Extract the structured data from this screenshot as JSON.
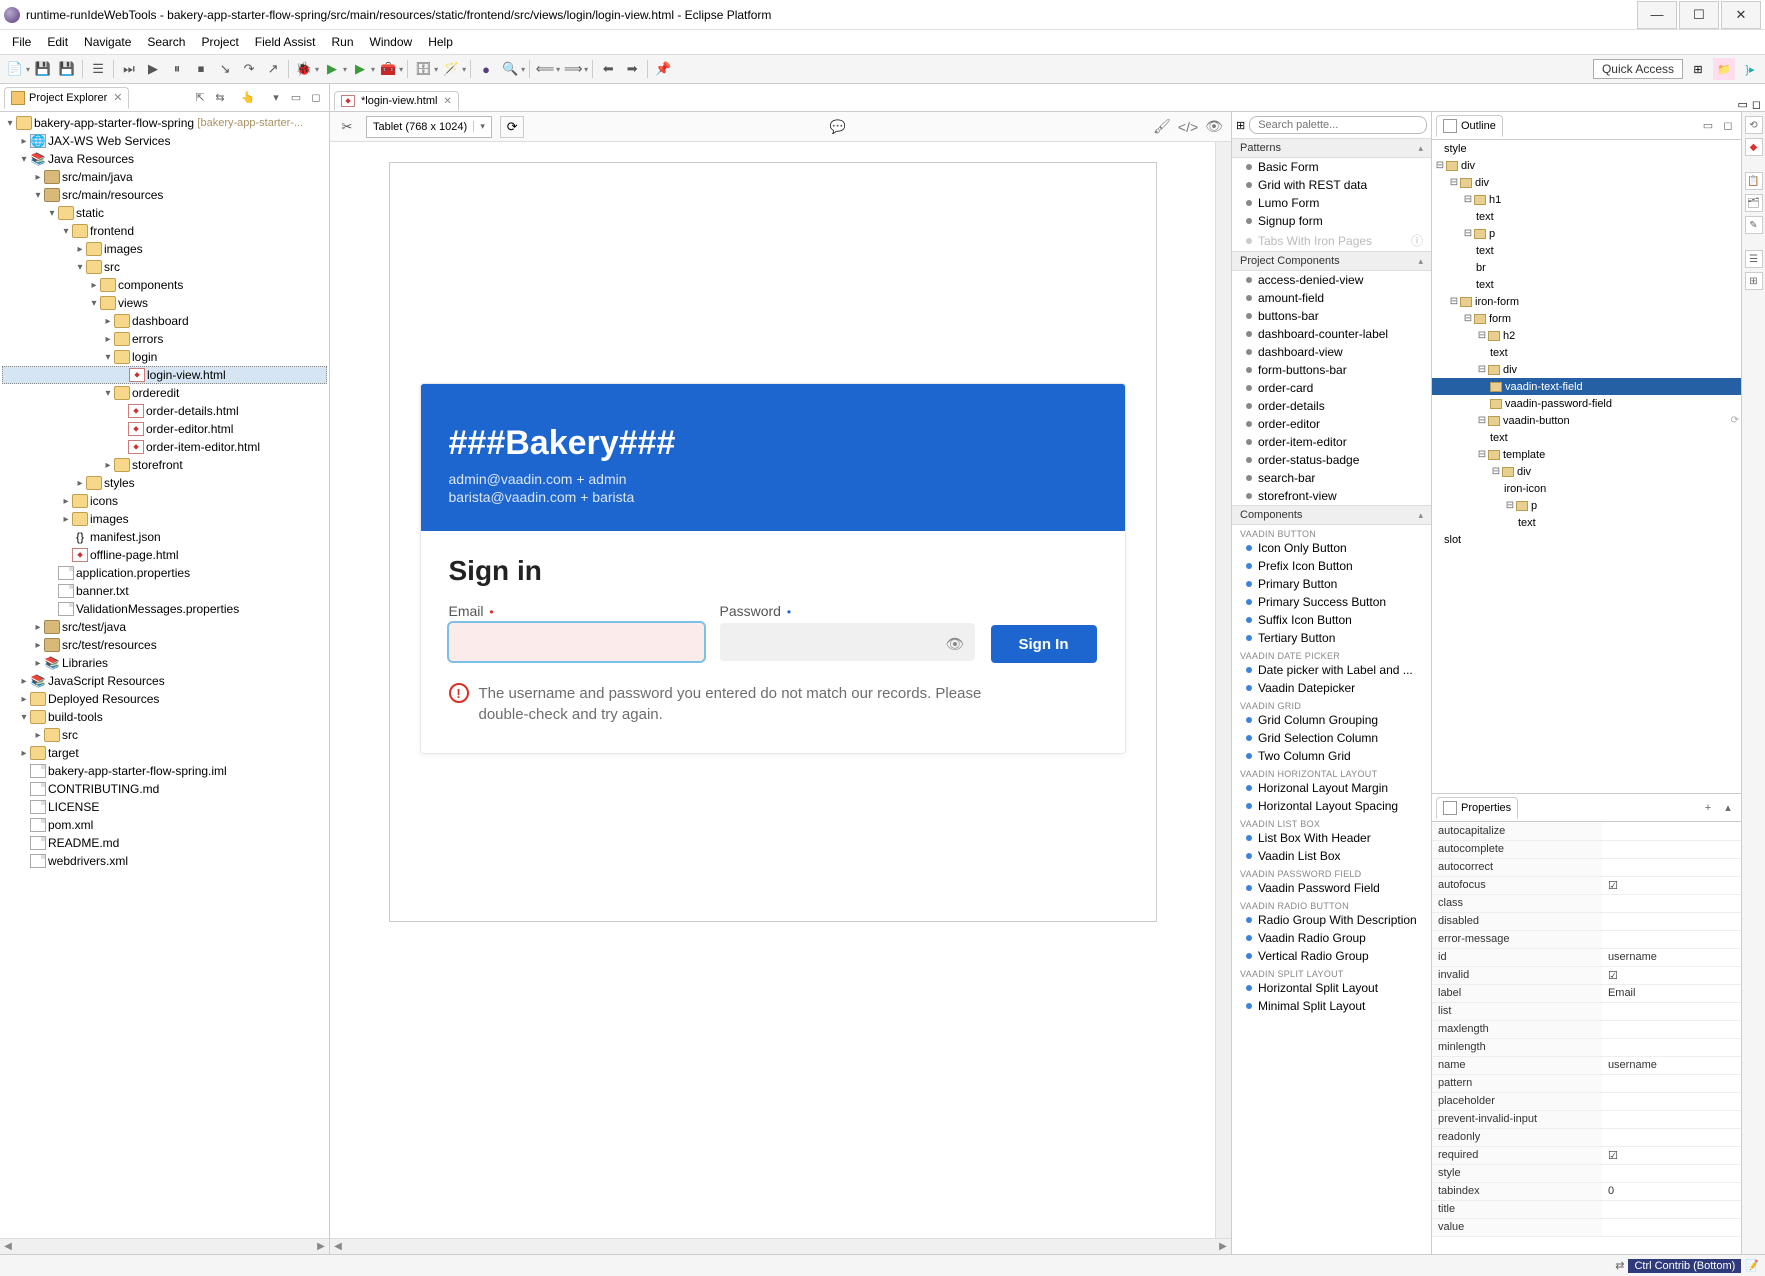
{
  "title": "runtime-runIdeWebTools - bakery-app-starter-flow-spring/src/main/resources/static/frontend/src/views/login/login-view.html - Eclipse Platform",
  "menu": {
    "file": "File",
    "edit": "Edit",
    "navigate": "Navigate",
    "search": "Search",
    "project": "Project",
    "fieldassist": "Field Assist",
    "run": "Run",
    "window": "Window",
    "help": "Help"
  },
  "quick_access": "Quick Access",
  "explorer": {
    "title": "Project Explorer",
    "project": "bakery-app-starter-flow-spring",
    "project_decor": "[bakery-app-starter-...",
    "webservices": "JAX-WS Web Services",
    "javares": "Java Resources",
    "srcmainjava": "src/main/java",
    "srcmainres": "src/main/resources",
    "static": "static",
    "frontend": "frontend",
    "images": "images",
    "src": "src",
    "components": "components",
    "views": "views",
    "dashboard": "dashboard",
    "errors": "errors",
    "login": "login",
    "loginview": "login-view.html",
    "orderedit": "orderedit",
    "orderdetails": "order-details.html",
    "ordereditor": "order-editor.html",
    "orderitemeditor": "order-item-editor.html",
    "storefront": "storefront",
    "styles": "styles",
    "icons": "icons",
    "images2": "images",
    "manifest": "manifest.json",
    "offlinepage": "offline-page.html",
    "appprops": "application.properties",
    "banner": "banner.txt",
    "valmsgs": "ValidationMessages.properties",
    "srctestjava": "src/test/java",
    "srctestres": "src/test/resources",
    "libraries": "Libraries",
    "jsres": "JavaScript Resources",
    "depres": "Deployed Resources",
    "buildtools": "build-tools",
    "src2": "src",
    "target": "target",
    "iml": "bakery-app-starter-flow-spring.iml",
    "contributing": "CONTRIBUTING.md",
    "license": "LICENSE",
    "pom": "pom.xml",
    "readme": "README.md",
    "webdrivers": "webdrivers.xml"
  },
  "editor": {
    "tab": "*login-view.html",
    "device": "Tablet (768 x 1024)"
  },
  "login": {
    "title": "###Bakery###",
    "creds1": "admin@vaadin.com + admin",
    "creds2": "barista@vaadin.com + barista",
    "signin_heading": "Sign in",
    "email_label": "Email",
    "password_label": "Password",
    "signin_btn": "Sign In",
    "error": "The username and password you entered do not match our records. Please double-check and try again."
  },
  "palette": {
    "search_placeholder": "Search palette...",
    "patterns": "Patterns",
    "p_basicform": "Basic Form",
    "p_gridrest": "Grid with REST data",
    "p_lumoform": "Lumo Form",
    "p_signupform": "Signup form",
    "p_tabsiron": "Tabs With Iron Pages",
    "projcomp": "Project Components",
    "pc_1": "access-denied-view",
    "pc_2": "amount-field",
    "pc_3": "buttons-bar",
    "pc_4": "dashboard-counter-label",
    "pc_5": "dashboard-view",
    "pc_6": "form-buttons-bar",
    "pc_7": "order-card",
    "pc_8": "order-details",
    "pc_9": "order-editor",
    "pc_10": "order-item-editor",
    "pc_11": "order-status-badge",
    "pc_12": "search-bar",
    "pc_13": "storefront-view",
    "components_hdr": "Components",
    "vbtn_hdr": "VAADIN BUTTON",
    "vb_1": "Icon Only Button",
    "vb_2": "Prefix Icon Button",
    "vb_3": "Primary Button",
    "vb_4": "Primary Success Button",
    "vb_5": "Suffix Icon Button",
    "vb_6": "Tertiary Button",
    "vdate_hdr": "VAADIN DATE PICKER",
    "vd_1": "Date picker with Label and ...",
    "vd_2": "Vaadin Datepicker",
    "vgrid_hdr": "VAADIN GRID",
    "vg_1": "Grid Column Grouping",
    "vg_2": "Grid Selection Column",
    "vg_3": "Two Column Grid",
    "vhl_hdr": "VAADIN HORIZONTAL LAYOUT",
    "vhl_1": "Horizonal Layout Margin",
    "vhl_2": "Horizontal Layout Spacing",
    "vlb_hdr": "VAADIN LIST BOX",
    "vlb_1": "List Box With Header",
    "vlb_2": "Vaadin List Box",
    "vpf_hdr": "VAADIN PASSWORD FIELD",
    "vpf_1": "Vaadin Password Field",
    "vrb_hdr": "VAADIN RADIO BUTTON",
    "vrb_1": "Radio Group With Description",
    "vrb_2": "Vaadin Radio Group",
    "vrb_3": "Vertical Radio Group",
    "vsl_hdr": "VAADIN SPLIT LAYOUT",
    "vsl_1": "Horizontal Split Layout",
    "vsl_2": "Minimal Split Layout"
  },
  "outline": {
    "title": "Outline",
    "n_style": "style",
    "n_div": "div",
    "n_div2": "div",
    "n_h1": "h1",
    "n_text": "text",
    "n_p": "p",
    "n_br": "br",
    "n_ironform": "iron-form",
    "n_form": "form",
    "n_h2": "h2",
    "n_div3": "div",
    "n_vtf": "vaadin-text-field",
    "n_vpf": "vaadin-password-field",
    "n_vbtn": "vaadin-button",
    "n_template": "template",
    "n_ironicon": "iron-icon",
    "n_slot": "slot"
  },
  "props": {
    "title": "Properties",
    "r_autocapitalize": "autocapitalize",
    "r_autocomplete": "autocomplete",
    "r_autocorrect": "autocorrect",
    "r_autofocus": "autofocus",
    "r_class": "class",
    "r_disabled": "disabled",
    "r_errormessage": "error-message",
    "r_id": "id",
    "r_invalid": "invalid",
    "r_label": "label",
    "r_list": "list",
    "r_maxlength": "maxlength",
    "r_minlength": "minlength",
    "r_name": "name",
    "r_pattern": "pattern",
    "r_placeholder": "placeholder",
    "r_preventinvalid": "prevent-invalid-input",
    "r_readonly": "readonly",
    "r_required": "required",
    "r_style": "style",
    "r_tabindex": "tabindex",
    "r_title": "title",
    "r_value": "value",
    "v_id": "username",
    "v_label": "Email",
    "v_name": "username",
    "v_tabindex": "0"
  },
  "status": {
    "ctrl": "Ctrl Contrib (Bottom)"
  }
}
